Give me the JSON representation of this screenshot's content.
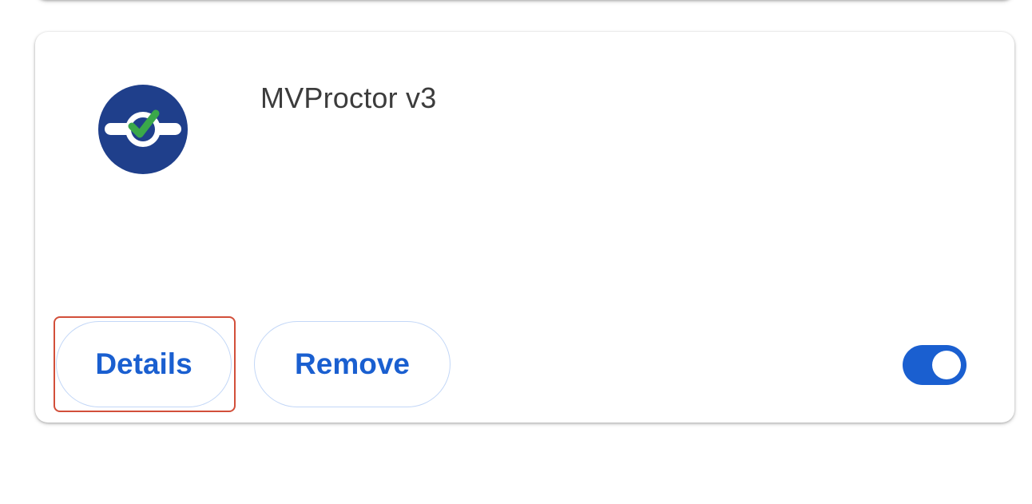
{
  "extension": {
    "name": "MVProctor v3",
    "icon": "mvproctor-logo-icon",
    "icon_colors": {
      "background": "#1f3f8b",
      "check": "#3aa84a",
      "band": "#ffffff"
    }
  },
  "actions": {
    "details_label": "Details",
    "remove_label": "Remove"
  },
  "toggle": {
    "enabled": true,
    "color": "#1a5fd0"
  },
  "highlight_color": "#d24f3a"
}
